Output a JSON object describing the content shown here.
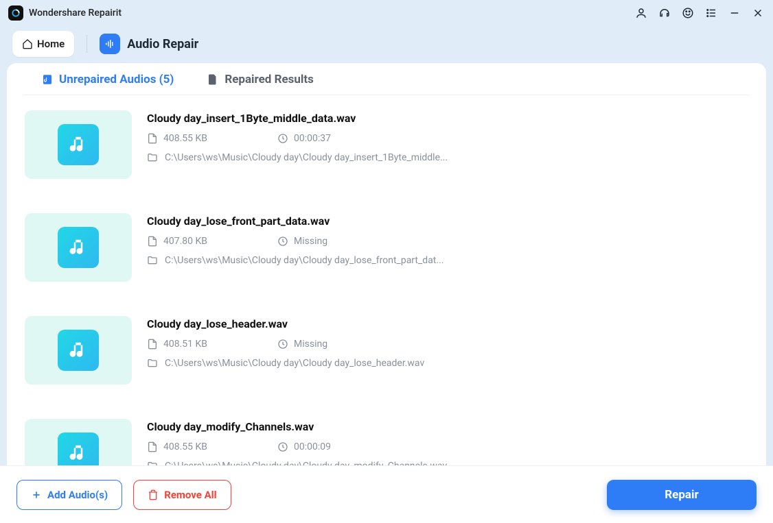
{
  "app": {
    "title": "Wondershare Repairit"
  },
  "nav": {
    "home_label": "Home",
    "section_title": "Audio Repair"
  },
  "tabs": {
    "unrepaired_label": "Unrepaired Audios (5)",
    "repaired_label": "Repaired Results"
  },
  "items": [
    {
      "name": "Cloudy day_insert_1Byte_middle_data.wav",
      "size": "408.55 KB",
      "duration": "00:00:37",
      "path": "C:\\Users\\ws\\Music\\Cloudy day\\Cloudy day_insert_1Byte_middle..."
    },
    {
      "name": "Cloudy day_lose_front_part_data.wav",
      "size": "407.80 KB",
      "duration": "Missing",
      "path": "C:\\Users\\ws\\Music\\Cloudy day\\Cloudy day_lose_front_part_dat..."
    },
    {
      "name": "Cloudy day_lose_header.wav",
      "size": "408.51 KB",
      "duration": "Missing",
      "path": "C:\\Users\\ws\\Music\\Cloudy day\\Cloudy day_lose_header.wav"
    },
    {
      "name": "Cloudy day_modify_Channels.wav",
      "size": "408.55 KB",
      "duration": "00:00:09",
      "path": "C:\\Users\\ws\\Music\\Cloudy day\\Cloudy day_modify_Channels.wav"
    }
  ],
  "actions": {
    "add_label": "Add Audio(s)",
    "remove_label": "Remove All",
    "repair_label": "Repair"
  }
}
